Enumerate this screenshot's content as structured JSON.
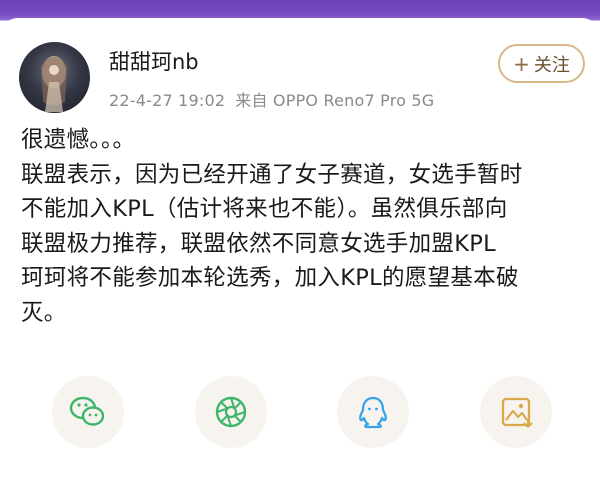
{
  "post": {
    "username": "甜甜珂nb",
    "timestamp": "22-4-27 19:02",
    "source": "来自 OPPO Reno7 Pro 5G",
    "follow_label": "关注",
    "body_lines": [
      "很遗憾。。。",
      "联盟表示，因为已经开通了女子赛道，女选手暂时",
      "不能加入KPL（估计将来也不能）。虽然俱乐部向",
      "联盟极力推荐，联盟依然不同意女选手加盟KPL",
      "珂珂将不能参加本轮选秀，加入KPL的愿望基本破",
      "灭。"
    ]
  },
  "share": {
    "items": [
      "wechat-icon",
      "moments-icon",
      "qq-icon",
      "save-image-icon"
    ]
  },
  "colors": {
    "accent_follow": "#d8b88a",
    "wechat": "#3db56b",
    "moments": "#3db56b",
    "qq": "#3ba4e8",
    "save_image": "#d9a94a"
  }
}
